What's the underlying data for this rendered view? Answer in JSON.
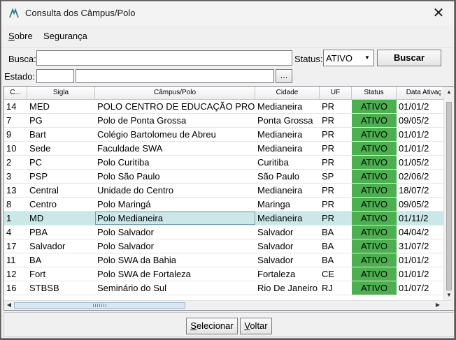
{
  "window": {
    "title": "Consulta dos Câmpus/Polo"
  },
  "menu": {
    "items": [
      {
        "pre": "",
        "ul": "S",
        "post": "obre"
      },
      {
        "pre": "",
        "ul": "",
        "post": "Segurança"
      }
    ]
  },
  "search": {
    "busca_label": "Busca:",
    "busca_value": "",
    "status_label": "Status:",
    "status_value": "ATIVO",
    "buscar_label": "Buscar",
    "estado_label": "Estado:",
    "estado_code": "",
    "estado_name": "",
    "ellipsis_label": "..."
  },
  "table": {
    "columns": [
      "C...",
      "Sigla",
      "Câmpus/Polo",
      "Cidade",
      "UF",
      "Status",
      "Data Ativaç"
    ],
    "rows": [
      {
        "code": "14",
        "sigla": "MED",
        "campus": " POLO CENTRO DE EDUCAÇÃO PRO...",
        "cidade": "Medianeira",
        "uf": "PR",
        "status": "ATIVO",
        "data": "01/01/2"
      },
      {
        "code": "7",
        "sigla": "PG",
        "campus": "Polo de Ponta Grossa",
        "cidade": "Ponta Grossa",
        "uf": "PR",
        "status": "ATIVO",
        "data": "09/05/2"
      },
      {
        "code": "9",
        "sigla": "Bart",
        "campus": "Colégio Bartolomeu de Abreu",
        "cidade": "Medianeira",
        "uf": "PR",
        "status": "ATIVO",
        "data": "01/01/2"
      },
      {
        "code": "10",
        "sigla": "Sede",
        "campus": "Faculdade SWA",
        "cidade": "Medianeira",
        "uf": "PR",
        "status": "ATIVO",
        "data": "01/01/2"
      },
      {
        "code": "2",
        "sigla": "PC",
        "campus": "Polo Curitiba",
        "cidade": "Curitiba",
        "uf": "PR",
        "status": "ATIVO",
        "data": "01/05/2"
      },
      {
        "code": "3",
        "sigla": "PSP",
        "campus": "Polo São Paulo",
        "cidade": "São Paulo",
        "uf": "SP",
        "status": "ATIVO",
        "data": "02/06/2"
      },
      {
        "code": "13",
        "sigla": "Central",
        "campus": "Unidade do Centro",
        "cidade": "Medianeira",
        "uf": "PR",
        "status": "ATIVO",
        "data": "18/07/2"
      },
      {
        "code": "8",
        "sigla": "Centro",
        "campus": "Polo Maringá",
        "cidade": "Maringa",
        "uf": "PR",
        "status": "ATIVO",
        "data": "09/05/2"
      },
      {
        "code": "1",
        "sigla": "MD",
        "campus": "Polo Medianeira",
        "cidade": "Medianeira",
        "uf": "PR",
        "status": "ATIVO",
        "data": "01/11/2",
        "selected": true
      },
      {
        "code": "4",
        "sigla": "PBA",
        "campus": "Polo Salvador",
        "cidade": "Salvador",
        "uf": "BA",
        "status": "ATIVO",
        "data": "04/04/2"
      },
      {
        "code": "17",
        "sigla": "Salvador",
        "campus": "Polo Salvador",
        "cidade": "Salvador",
        "uf": "BA",
        "status": "ATIVO",
        "data": "31/07/2"
      },
      {
        "code": "11",
        "sigla": "BA",
        "campus": "Polo SWA da Bahia",
        "cidade": "Salvador",
        "uf": "BA",
        "status": "ATIVO",
        "data": "01/01/2"
      },
      {
        "code": "12",
        "sigla": "Fort",
        "campus": "Polo SWA de Fortaleza",
        "cidade": "Fortaleza",
        "uf": "CE",
        "status": "ATIVO",
        "data": "01/01/2"
      },
      {
        "code": "16",
        "sigla": "STBSB",
        "campus": "Seminário do Sul",
        "cidade": "Rio De Janeiro",
        "uf": "RJ",
        "status": "ATIVO",
        "data": "01/07/2"
      }
    ]
  },
  "footer": {
    "selecionar": {
      "ul": "S",
      "post": "elecionar"
    },
    "voltar": {
      "ul": "V",
      "post": "oltar"
    }
  },
  "colors": {
    "status_active": "#4caf50",
    "row_selected": "#cbe8e8"
  }
}
